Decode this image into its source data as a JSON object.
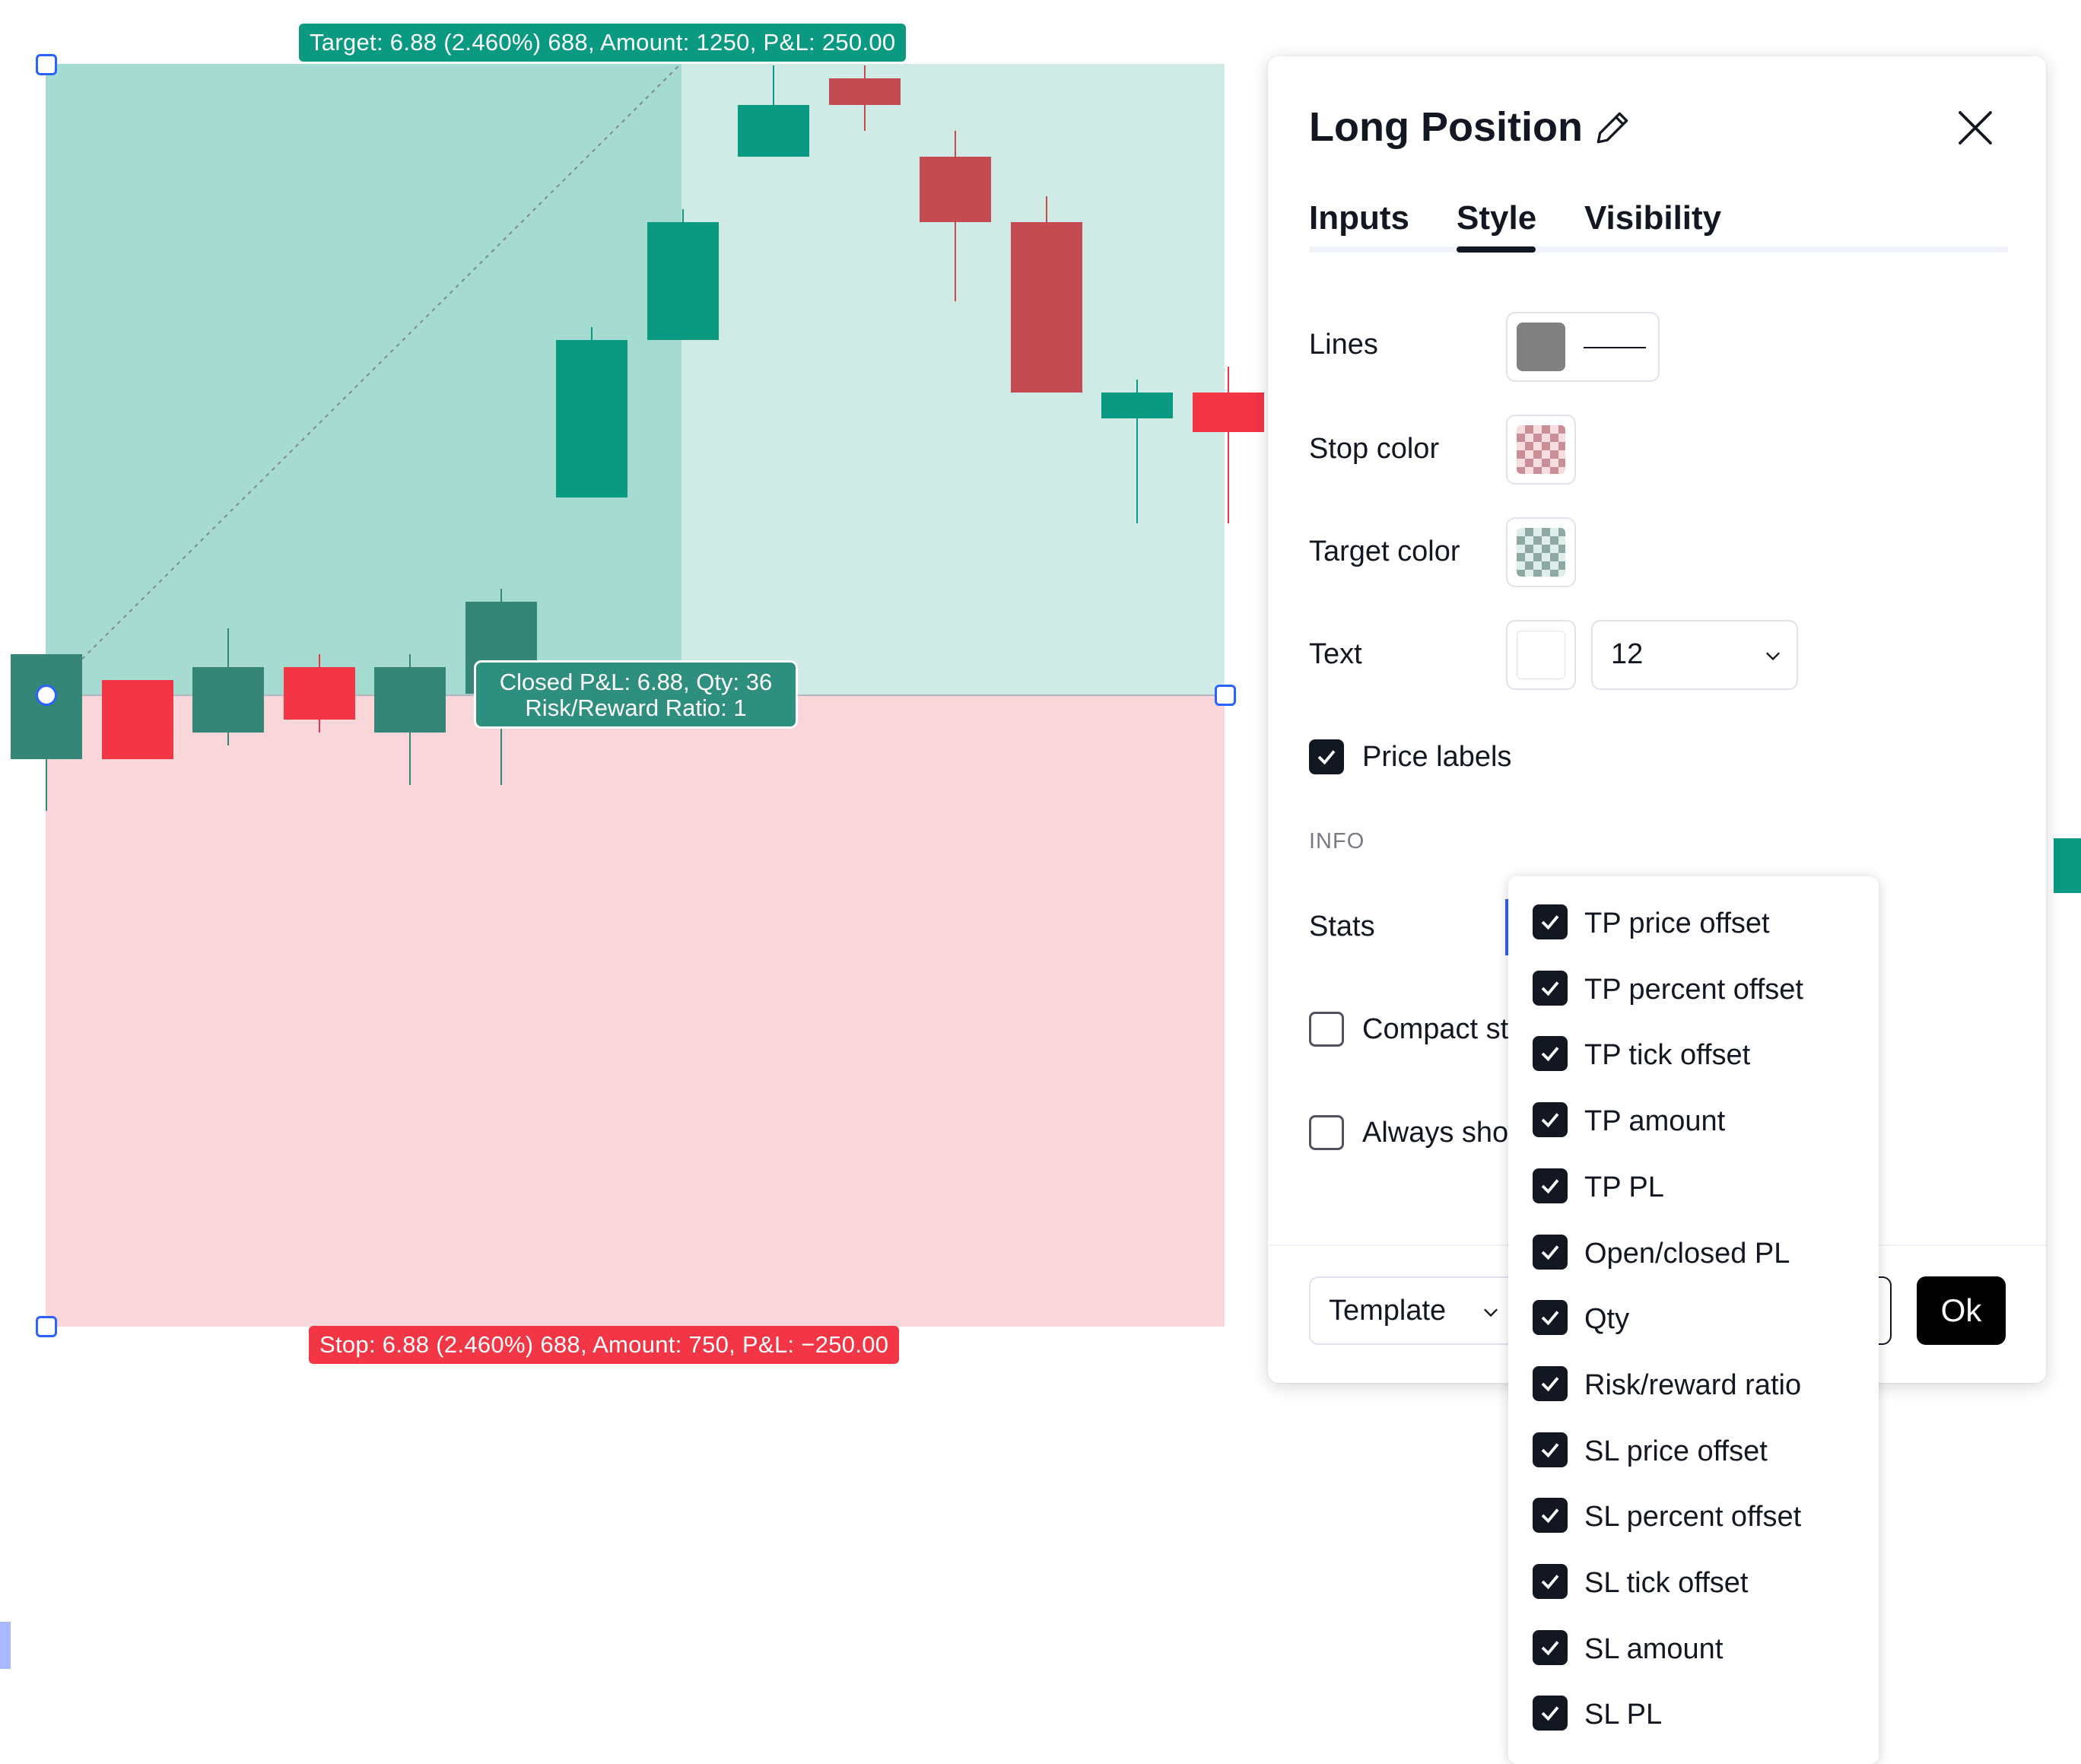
{
  "chart": {
    "target_label": "Target: 6.88 (2.460%) 688, Amount: 1250, P&L: 250.00",
    "stop_label": "Stop: 6.88 (2.460%) 688, Amount: 750, P&L: −250.00",
    "closed_label_line1": "Closed P&L: 6.88, Qty: 36",
    "closed_label_line2": "Risk/Reward Ratio: 1",
    "colors": {
      "target_fill": "#d0ebe5",
      "target_fill_active": "#a6dbd1",
      "stop_fill": "#f9d6da",
      "up_candle": "#0a9981",
      "down_candle": "#c44a52",
      "up_candle_dim": "#368677",
      "down_candle_bright": "#f23645",
      "handle_border": "#2962ff"
    },
    "ohlc": [
      {
        "o": 130,
        "h": 130,
        "l": 142,
        "c": 138,
        "dir": "up",
        "tone": "dim"
      },
      {
        "o": 132,
        "h": 132,
        "l": 138,
        "c": 138,
        "dir": "down",
        "tone": "bright"
      },
      {
        "o": 131,
        "h": 128,
        "l": 137,
        "c": 136,
        "dir": "up",
        "tone": "dim"
      },
      {
        "o": 131,
        "h": 130,
        "l": 136,
        "c": 135,
        "dir": "down",
        "tone": "bright"
      },
      {
        "o": 131,
        "h": 130,
        "l": 140,
        "c": 136,
        "dir": "up",
        "tone": "dim"
      },
      {
        "o": 126,
        "h": 125,
        "l": 140,
        "c": 133,
        "dir": "up",
        "tone": "dim"
      },
      {
        "o": 106,
        "h": 105,
        "l": 118,
        "c": 118,
        "dir": "up",
        "tone": "normal"
      },
      {
        "o": 97,
        "h": 96,
        "l": 106,
        "c": 106,
        "dir": "up",
        "tone": "normal"
      },
      {
        "o": 88,
        "h": 85,
        "l": 92,
        "c": 92,
        "dir": "up",
        "tone": "normal"
      },
      {
        "o": 88,
        "h": 85,
        "l": 90,
        "c": 86,
        "dir": "down",
        "tone": "normal"
      },
      {
        "o": 92,
        "h": 90,
        "l": 103,
        "c": 97,
        "dir": "down",
        "tone": "normal"
      },
      {
        "o": 97,
        "h": 95,
        "l": 110,
        "c": 110,
        "dir": "down",
        "tone": "normal"
      },
      {
        "o": 110,
        "h": 109,
        "l": 120,
        "c": 112,
        "dir": "up",
        "tone": "normal"
      },
      {
        "o": 110,
        "h": 108,
        "l": 120,
        "c": 113,
        "dir": "down",
        "tone": "bright"
      }
    ]
  },
  "dialog": {
    "title": "Long Position",
    "tabs": [
      "Inputs",
      "Style",
      "Visibility"
    ],
    "active_tab": "Style",
    "rows": {
      "lines": "Lines",
      "stop_color": "Stop color",
      "target_color": "Target color",
      "text": "Text",
      "text_size": "12",
      "price_labels": "Price labels",
      "info_header": "INFO",
      "stats": "Stats",
      "compact_stats": "Compact st",
      "always_show": "Always sho"
    },
    "price_labels_checked": true,
    "compact_checked": false,
    "always_checked": false,
    "template": "Template",
    "ok": "Ok"
  },
  "dropdown": {
    "items": [
      {
        "label": "TP price offset",
        "checked": true
      },
      {
        "label": "TP percent offset",
        "checked": true
      },
      {
        "label": "TP tick offset",
        "checked": true
      },
      {
        "label": "TP amount",
        "checked": true
      },
      {
        "label": "TP PL",
        "checked": true
      },
      {
        "label": "Open/closed PL",
        "checked": true
      },
      {
        "label": "Qty",
        "checked": true
      },
      {
        "label": "Risk/reward ratio",
        "checked": true
      },
      {
        "label": "SL price offset",
        "checked": true
      },
      {
        "label": "SL percent offset",
        "checked": true
      },
      {
        "label": "SL tick offset",
        "checked": true
      },
      {
        "label": "SL amount",
        "checked": true
      },
      {
        "label": "SL PL",
        "checked": true
      }
    ]
  }
}
